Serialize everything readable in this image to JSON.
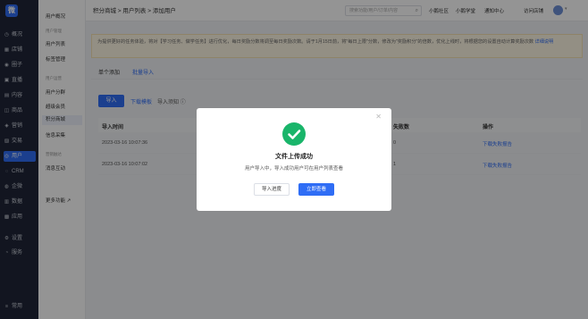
{
  "sidebar": {
    "logo": "微",
    "items": [
      {
        "label": "概况",
        "icon": "◷"
      },
      {
        "label": "店铺",
        "icon": "▦"
      },
      {
        "label": "圈子",
        "icon": "◉"
      },
      {
        "label": "直播",
        "icon": "▣"
      },
      {
        "label": "内容",
        "icon": "▤"
      },
      {
        "label": "商品",
        "icon": "◫"
      },
      {
        "label": "营销",
        "icon": "◈"
      },
      {
        "label": "交易",
        "icon": "▨"
      },
      {
        "label": "用户",
        "icon": "◎"
      },
      {
        "label": "CRM",
        "icon": "◌"
      },
      {
        "label": "企微",
        "icon": "◍"
      },
      {
        "label": "数据",
        "icon": "▥"
      },
      {
        "label": "应用",
        "icon": "▩"
      },
      {
        "label": "设置",
        "icon": "⚙"
      },
      {
        "label": "服务",
        "icon": "◔"
      }
    ],
    "bottom": "常用"
  },
  "subnav": {
    "top_item": "用户概况",
    "group1": "用户管理",
    "g1_items": [
      "用户列表",
      "标签管理"
    ],
    "group2": "用户运营",
    "g2_items": [
      "用户分群",
      "超级会员",
      "积分商城",
      "信息采集"
    ],
    "group3": "营销触达",
    "g3_items": [
      "消息互动"
    ],
    "more": "更多功能"
  },
  "topbar": {
    "breadcrumb": "积分商城 > 用户列表 > 添加用户",
    "search_placeholder": "搜索功能/用户/订单/内容",
    "links": [
      "小鹅社区",
      "小鹅学堂",
      "通知中心",
      "访问店铺"
    ]
  },
  "notice": {
    "text": "为提供更好的任务体验，将对【学习任务、做学任务】进行优化，每日奖励分数将调至每日奖励次数。请于1月15日前，将\"每日上限\"分数，修改为\"奖励积分\"的倍数，优化上线时，将根据您的设置自动计算奖励次数",
    "link": "详细说明"
  },
  "tabs": [
    "单个添加",
    "批量导入"
  ],
  "actions": {
    "import": "导入",
    "download_template": "下载模板",
    "import_records": "导入须知"
  },
  "table": {
    "headers": [
      "导入时间",
      "失败数",
      "操作"
    ],
    "rows": [
      {
        "time": "2023-03-16 10:07:36",
        "fail": "0",
        "action": "下载失败报告"
      },
      {
        "time": "2023-03-16 10:07:02",
        "fail": "1",
        "action": "下载失败报告"
      }
    ]
  },
  "modal": {
    "title": "文件上传成功",
    "desc": "用户导入中，导入成功用户可在用户列表查看",
    "btn_secondary": "导入进度",
    "btn_primary": "立即查看"
  },
  "colors": {
    "accent": "#2f6df5",
    "success": "#19b56a",
    "sidebar": "#1f2537"
  }
}
